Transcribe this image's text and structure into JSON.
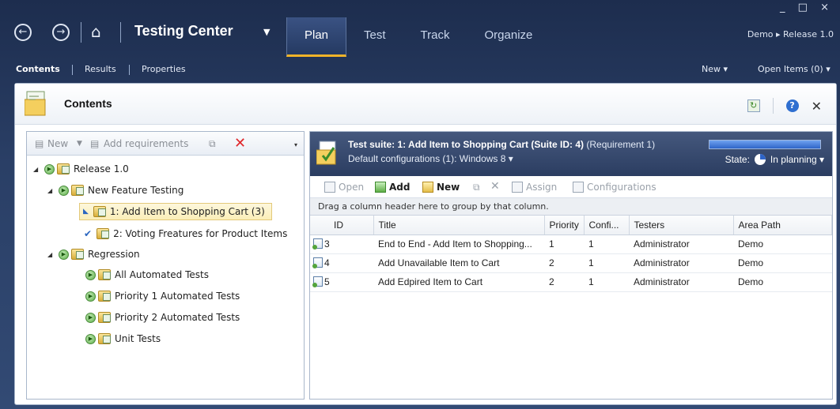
{
  "app": {
    "title": "Testing Center",
    "tabs": [
      "Plan",
      "Test",
      "Track",
      "Organize"
    ],
    "active_tab": "Plan",
    "window_controls": "_ □ ×",
    "project_breadcrumb": "Demo ▸ Release 1.0"
  },
  "subnav": {
    "items": [
      "Contents",
      "Results",
      "Properties"
    ],
    "new_label": "New ▾",
    "open_items_label": "Open Items (0) ▾"
  },
  "panel": {
    "title": "Contents"
  },
  "tree_toolbar": {
    "new_label": "New",
    "add_requirements_label": "Add requirements"
  },
  "tree": [
    {
      "label": "Release 1.0"
    },
    {
      "label": "New Feature Testing"
    },
    {
      "label": "1: Add Item to Shopping Cart (3)"
    },
    {
      "label": "2: Voting Freatures for Product Items"
    },
    {
      "label": "Regression"
    },
    {
      "label": "All Automated Tests"
    },
    {
      "label": "Priority 1 Automated Tests"
    },
    {
      "label": "Priority 2 Automated Tests"
    },
    {
      "label": "Unit Tests"
    }
  ],
  "suite": {
    "prefix": "Test suite:",
    "name": "1: Add Item to Shopping Cart (Suite ID: 4)",
    "requirement": "(Requirement 1)",
    "configs": "Default configurations (1):  Windows 8 ▾",
    "state_label": "State:",
    "state_value": "In planning ▾",
    "progress": 1.0
  },
  "suite_toolbar": {
    "open": "Open",
    "add": "Add",
    "new": "New",
    "assign": "Assign",
    "configurations": "Configurations"
  },
  "group_hint": "Drag a column header here to group by that column.",
  "grid": {
    "columns": [
      "ID",
      "Title",
      "Priority",
      "Confi...",
      "Testers",
      "Area Path"
    ],
    "rows": [
      {
        "id": "3",
        "title": "End to End - Add Item to Shopping...",
        "priority": "1",
        "config": "1",
        "testers": "Administrator",
        "area": "Demo"
      },
      {
        "id": "4",
        "title": "Add Unavailable Item to Cart",
        "priority": "2",
        "config": "1",
        "testers": "Administrator",
        "area": "Demo"
      },
      {
        "id": "5",
        "title": "Add Edpired Item to Cart",
        "priority": "2",
        "config": "1",
        "testers": "Administrator",
        "area": "Demo"
      }
    ]
  }
}
